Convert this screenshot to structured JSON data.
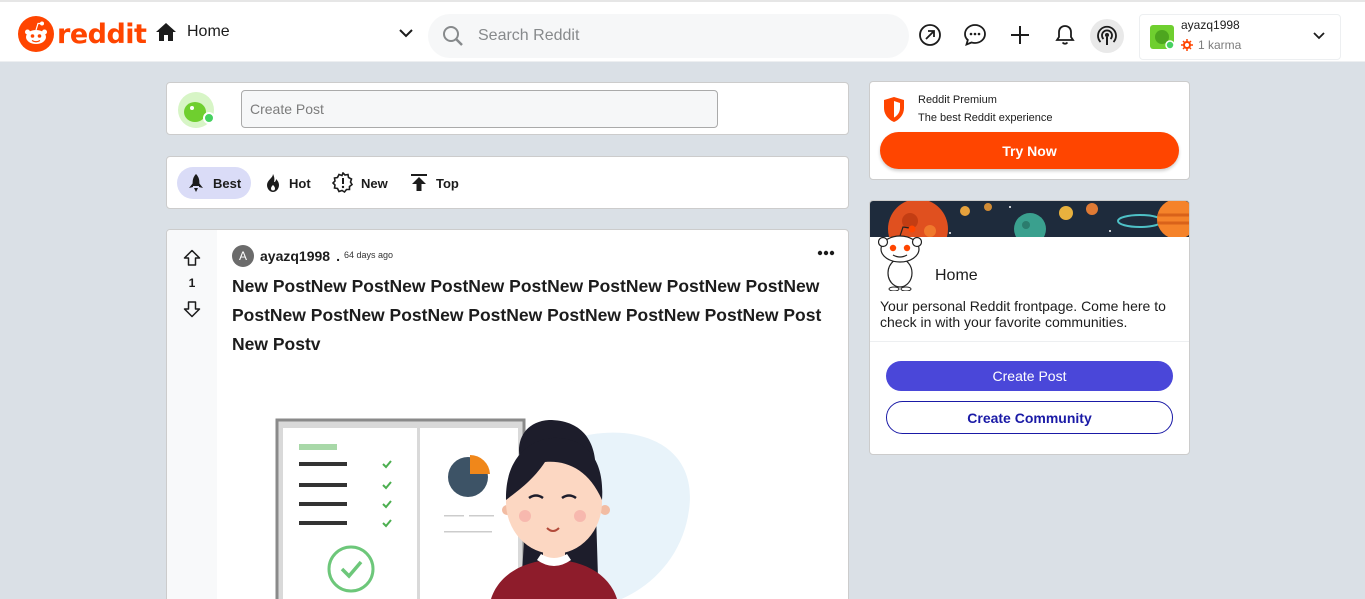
{
  "header": {
    "logo_text": "reddit",
    "home_label": "Home",
    "search_placeholder": "Search Reddit",
    "icons": [
      "popular-arrow-icon",
      "chat-icon",
      "plus-icon",
      "bell-icon",
      "podcast-icon"
    ],
    "user": {
      "name": "ayazq1998",
      "karma": "1 karma"
    }
  },
  "create_post": {
    "placeholder": "Create Post"
  },
  "sort": {
    "options": [
      {
        "label": "Best",
        "icon": "rocket-icon",
        "active": true
      },
      {
        "label": "Hot",
        "icon": "flame-icon",
        "active": false
      },
      {
        "label": "New",
        "icon": "new-badge-icon",
        "active": false
      },
      {
        "label": "Top",
        "icon": "top-arrow-icon",
        "active": false
      }
    ]
  },
  "post": {
    "votes": "1",
    "author_initial": "A",
    "author": "ayazq1998",
    "separator": ".",
    "time": "64 days ago",
    "title": "New PostNew PostNew PostNew PostNew PostNew PostNew PostNew PostNew PostNew PostNew PostNew PostNew PostNew PostNew PostNew Postv"
  },
  "premium": {
    "title": "Reddit Premium",
    "subtitle": "The best Reddit experience",
    "button": "Try Now"
  },
  "home_card": {
    "title": "Home",
    "description": "Your personal Reddit frontpage. Come here to check in with your favorite communities.",
    "create_post_button": "Create Post",
    "create_community_button": "Create Community"
  },
  "colors": {
    "brand": "#ff4500",
    "accent": "#4a47d9",
    "background": "#dae0e6"
  }
}
